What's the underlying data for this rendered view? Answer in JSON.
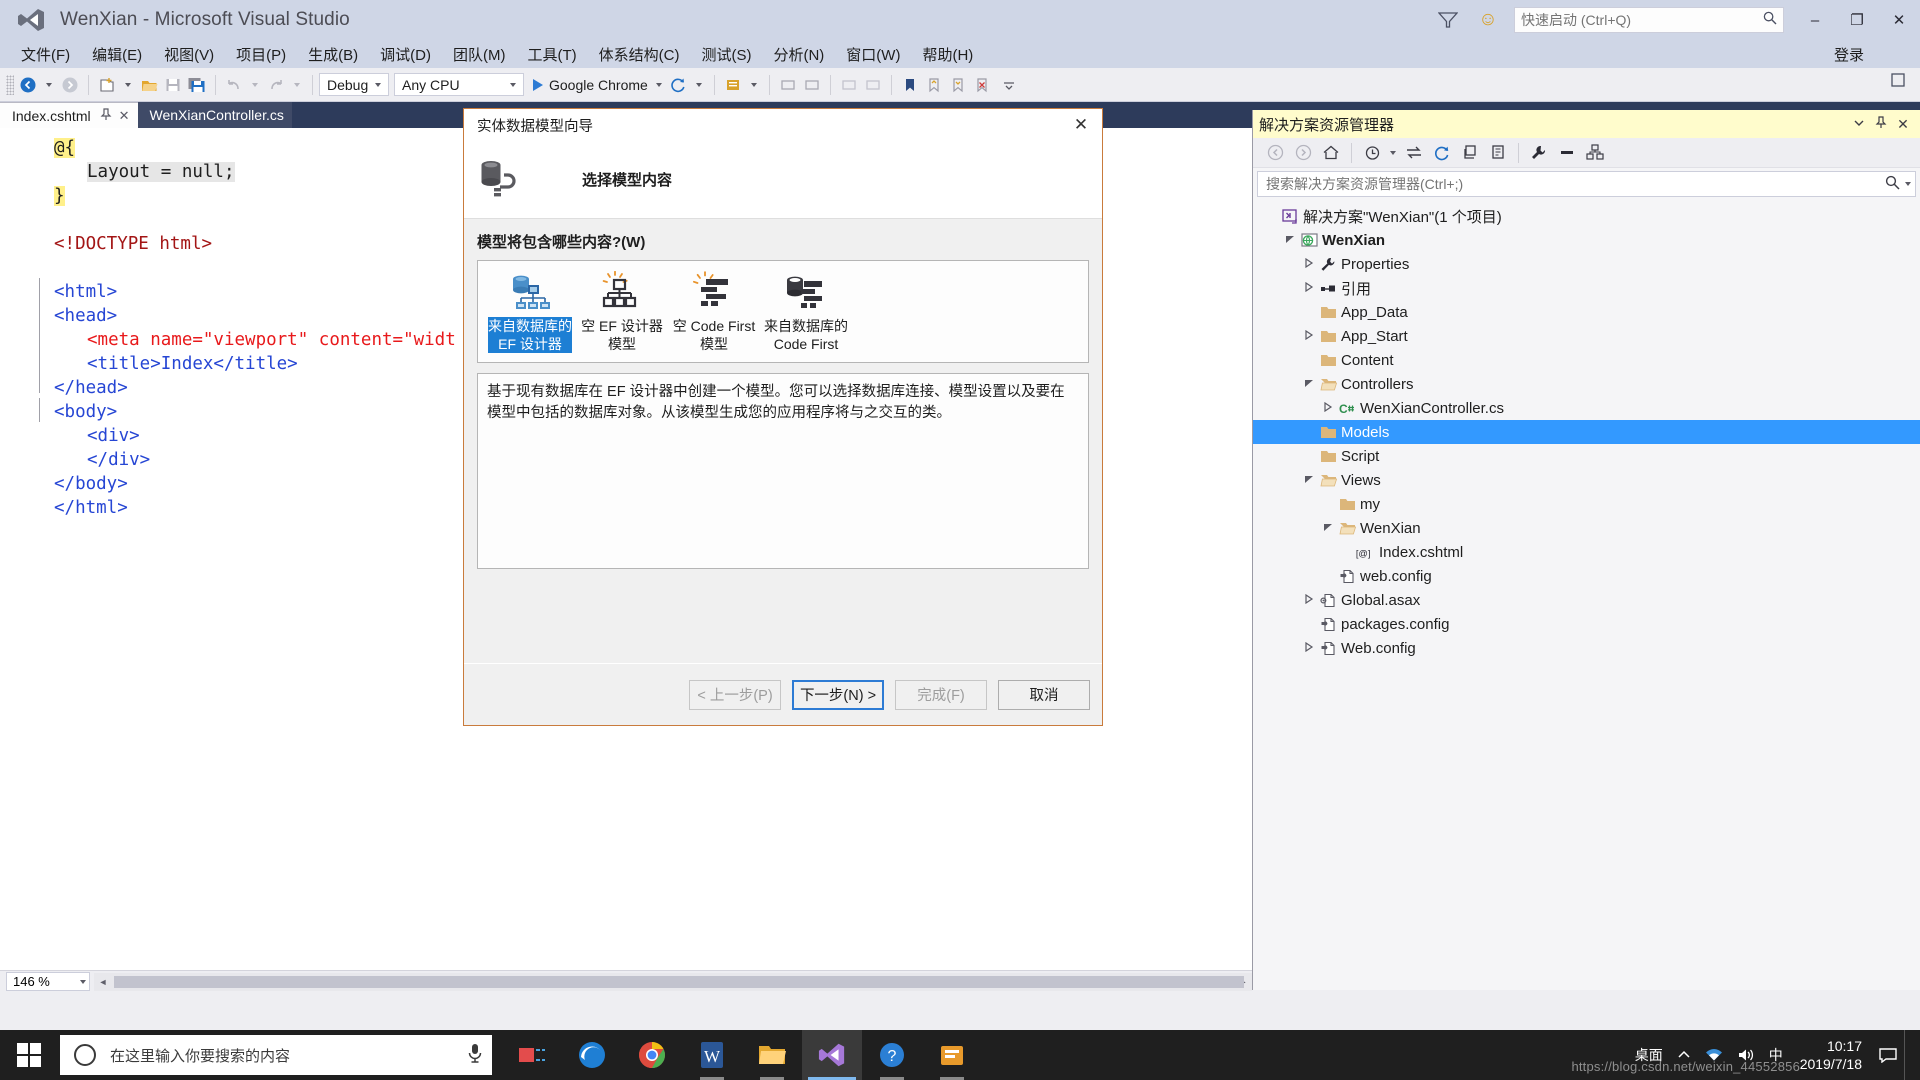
{
  "window": {
    "title": "WenXian - Microsoft Visual Studio",
    "logo_icon": "visual-studio-logo-icon",
    "notify_icon": "notifications-icon",
    "feedback_icon": "feedback-smiley-icon",
    "minimize": "–",
    "maximize": "❐",
    "close": "✕",
    "login_label": "登录",
    "maximize_small_icon": "window-restore-icon"
  },
  "quick_launch": {
    "placeholder": "快速启动 (Ctrl+Q)",
    "value": "",
    "icon": "search-icon"
  },
  "menu": {
    "items": [
      "文件(F)",
      "编辑(E)",
      "视图(V)",
      "项目(P)",
      "生成(B)",
      "调试(D)",
      "团队(M)",
      "工具(T)",
      "体系结构(C)",
      "测试(S)",
      "分析(N)",
      "窗口(W)",
      "帮助(H)"
    ]
  },
  "toolbar": {
    "back_icon": "navigate-back-icon",
    "forward_icon": "navigate-forward-icon",
    "new_project_icon": "new-project-icon",
    "open_file_icon": "open-file-icon",
    "save_icon": "save-icon",
    "save_all_icon": "save-all-icon",
    "undo_icon": "undo-icon",
    "redo_icon": "redo-icon",
    "configuration": "Debug",
    "platform": "Any CPU",
    "run_target": "Google Chrome",
    "run_icon": "play-icon",
    "more_icon": "overflow-chevron-icon",
    "bookmark_icon": "bookmark-icon",
    "extra_icons": [
      "comment-icon",
      "uncomment-icon",
      "indent-icon",
      "outdent-icon",
      "prev-bookmark-icon",
      "next-bookmark-icon"
    ]
  },
  "tabs": [
    {
      "label": "Index.cshtml",
      "active": true,
      "pin_icon": "pin-icon",
      "close_icon": "close-icon"
    },
    {
      "label": "WenXianController.cs",
      "active": false
    }
  ],
  "editor": {
    "zoom_level": "146 %",
    "lines": [
      {
        "indent": 0,
        "fold": "minus",
        "segments": [
          {
            "t": "@{",
            "c": "k-razor"
          }
        ]
      },
      {
        "indent": 1,
        "segments": [
          {
            "t": "Layout = null;",
            "c": "k-hl"
          }
        ]
      },
      {
        "indent": 0,
        "segments": [
          {
            "t": "}",
            "c": "k-razor"
          }
        ]
      },
      {
        "indent": 0,
        "segments": []
      },
      {
        "indent": 0,
        "segments": [
          {
            "t": "<!DOCTYPE html>",
            "c": "k-tagname"
          }
        ]
      },
      {
        "indent": 0,
        "segments": []
      },
      {
        "indent": 0,
        "fold": "minus",
        "segments": [
          {
            "t": "<html>",
            "c": "k-tag"
          }
        ]
      },
      {
        "indent": 0,
        "fold": "minus",
        "segments": [
          {
            "t": "<head>",
            "c": "k-tag"
          }
        ]
      },
      {
        "indent": 1,
        "segments": [
          {
            "t": "<meta name=\"viewport\" content=\"widt",
            "c": "k-attr"
          }
        ]
      },
      {
        "indent": 1,
        "segments": [
          {
            "t": "<title>Index</title>",
            "c": "k-tag"
          }
        ]
      },
      {
        "indent": 0,
        "segments": [
          {
            "t": "</head>",
            "c": "k-tag"
          }
        ]
      },
      {
        "indent": 0,
        "fold": "minus",
        "segments": [
          {
            "t": "<body>",
            "c": "k-tag"
          }
        ]
      },
      {
        "indent": 1,
        "segments": [
          {
            "t": "<div>",
            "c": "k-tag"
          }
        ]
      },
      {
        "indent": 1,
        "segments": [
          {
            "t": "</div>",
            "c": "k-tag"
          }
        ]
      },
      {
        "indent": 0,
        "segments": [
          {
            "t": "</body>",
            "c": "k-tag"
          }
        ]
      },
      {
        "indent": 0,
        "segments": [
          {
            "t": "</html>",
            "c": "k-tag"
          }
        ]
      }
    ]
  },
  "solution_explorer": {
    "title": "解决方案资源管理器",
    "dropdown_icon": "chevron-down-icon",
    "pin_icon": "pin-icon",
    "close_icon": "close-icon",
    "toolbar_icons": [
      "back-icon",
      "forward-icon",
      "home-icon",
      "pending-changes-icon",
      "sync-with-active-document-icon",
      "refresh-icon",
      "collapse-all-icon",
      "show-all-files-icon",
      "properties-icon",
      "preview-selected-items-icon",
      "view-class-diagram-icon"
    ],
    "search_placeholder": "搜索解决方案资源管理器(Ctrl+;)",
    "search_icon": "search-icon",
    "tree": [
      {
        "depth": 0,
        "twist": "",
        "icon": "solution-icon",
        "label": "解决方案\"WenXian\"(1 个项目)",
        "bold": false,
        "selected": false
      },
      {
        "depth": 1,
        "twist": "open",
        "icon": "web-project-icon",
        "label": "WenXian",
        "bold": true,
        "selected": false
      },
      {
        "depth": 2,
        "twist": "closed",
        "icon": "properties-wrench-icon",
        "label": "Properties",
        "bold": false,
        "selected": false
      },
      {
        "depth": 2,
        "twist": "closed",
        "icon": "references-icon",
        "label": "引用",
        "bold": false,
        "selected": false
      },
      {
        "depth": 2,
        "twist": "",
        "icon": "folder-icon",
        "label": "App_Data",
        "bold": false,
        "selected": false
      },
      {
        "depth": 2,
        "twist": "closed",
        "icon": "folder-icon",
        "label": "App_Start",
        "bold": false,
        "selected": false
      },
      {
        "depth": 2,
        "twist": "",
        "icon": "folder-icon",
        "label": "Content",
        "bold": false,
        "selected": false
      },
      {
        "depth": 2,
        "twist": "open",
        "icon": "folder-open-icon",
        "label": "Controllers",
        "bold": false,
        "selected": false
      },
      {
        "depth": 3,
        "twist": "closed",
        "icon": "csharp-file-icon",
        "label": "WenXianController.cs",
        "bold": false,
        "selected": false
      },
      {
        "depth": 2,
        "twist": "",
        "icon": "folder-icon",
        "label": "Models",
        "bold": false,
        "selected": true
      },
      {
        "depth": 2,
        "twist": "",
        "icon": "folder-icon",
        "label": "Script",
        "bold": false,
        "selected": false
      },
      {
        "depth": 2,
        "twist": "open",
        "icon": "folder-open-icon",
        "label": "Views",
        "bold": false,
        "selected": false
      },
      {
        "depth": 3,
        "twist": "",
        "icon": "folder-icon",
        "label": "my",
        "bold": false,
        "selected": false
      },
      {
        "depth": 3,
        "twist": "open",
        "icon": "folder-open-icon",
        "label": "WenXian",
        "bold": false,
        "selected": false
      },
      {
        "depth": 4,
        "twist": "",
        "icon": "razor-file-icon",
        "label": "Index.cshtml",
        "bold": false,
        "selected": false
      },
      {
        "depth": 3,
        "twist": "",
        "icon": "config-file-icon",
        "label": "web.config",
        "bold": false,
        "selected": false
      },
      {
        "depth": 2,
        "twist": "closed",
        "icon": "asax-file-icon",
        "label": "Global.asax",
        "bold": false,
        "selected": false
      },
      {
        "depth": 2,
        "twist": "",
        "icon": "config-file-icon",
        "label": "packages.config",
        "bold": false,
        "selected": false
      },
      {
        "depth": 2,
        "twist": "closed",
        "icon": "config-file-icon",
        "label": "Web.config",
        "bold": false,
        "selected": false
      }
    ]
  },
  "dialog": {
    "title": "实体数据模型向导",
    "close_icon": "close-icon",
    "banner_icon": "database-connection-icon",
    "banner_title": "选择模型内容",
    "question": "模型将包含哪些内容?(W)",
    "options": [
      {
        "icon": "ef-designer-from-database-icon",
        "label_line1": "来自数据库的",
        "label_line2": "EF 设计器",
        "selected": true
      },
      {
        "icon": "empty-ef-designer-model-icon",
        "label_line1": "空 EF 设计器",
        "label_line2": "模型",
        "selected": false
      },
      {
        "icon": "empty-code-first-model-icon",
        "label_line1": "空 Code First",
        "label_line2": "模型",
        "selected": false
      },
      {
        "icon": "code-first-from-database-icon",
        "label_line1": "来自数据库的",
        "label_line2": "Code First",
        "selected": false
      }
    ],
    "description": "基于现有数据库在 EF 设计器中创建一个模型。您可以选择数据库连接、模型设置以及要在模型中包括的数据库对象。从该模型生成您的应用程序将与之交互的类。",
    "buttons": {
      "previous": "< 上一步(P)",
      "next": "下一步(N) >",
      "finish": "完成(F)",
      "cancel": "取消"
    }
  },
  "taskbar": {
    "start_icon": "windows-start-icon",
    "search_placeholder": "在这里输入你要搜索的内容",
    "search_circle_icon": "cortana-circle-icon",
    "mic_icon": "microphone-icon",
    "apps": [
      {
        "icon": "task-view-icon",
        "name": "task-view"
      },
      {
        "icon": "edge-browser-icon",
        "name": "edge"
      },
      {
        "icon": "chrome-browser-icon",
        "name": "chrome"
      },
      {
        "icon": "word-icon",
        "name": "word"
      },
      {
        "icon": "file-explorer-icon",
        "name": "file-explorer"
      },
      {
        "icon": "visual-studio-icon",
        "name": "visual-studio"
      },
      {
        "icon": "help-icon",
        "name": "help"
      },
      {
        "icon": "store-icon",
        "name": "store"
      }
    ],
    "tray": {
      "desktop_label": "桌面",
      "chevron_icon": "show-hidden-icons-icon",
      "network_icon": "network-icon",
      "volume_icon": "volume-icon",
      "ime_label": "中",
      "notification_icon": "action-center-icon"
    },
    "clock_time": "10:17",
    "clock_date": "2019/7/18",
    "watermark": "https://blog.csdn.net/weixin_44552856"
  }
}
